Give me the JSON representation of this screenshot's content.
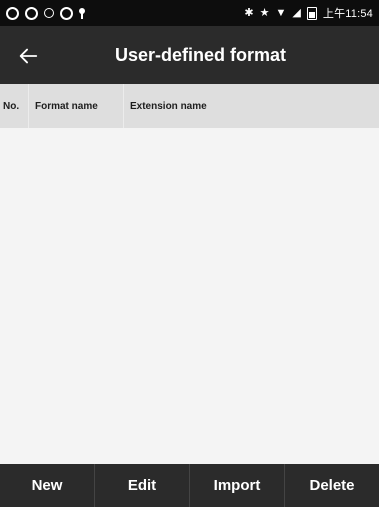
{
  "status_bar": {
    "time": "上午11:54",
    "icons": [
      "circle-icon",
      "circle-icon",
      "circle-icon",
      "circle-icon",
      "location-pin-icon",
      "bluetooth-icon",
      "star-icon",
      "wifi-icon",
      "signal-icon",
      "battery-icon"
    ]
  },
  "toolbar": {
    "back_icon": "arrow-left-icon",
    "title": "User-defined format"
  },
  "table": {
    "columns": [
      "No.",
      "Format name",
      "Extension name"
    ],
    "rows": []
  },
  "bottom_bar": {
    "buttons": [
      "New",
      "Edit",
      "Import",
      "Delete"
    ]
  }
}
